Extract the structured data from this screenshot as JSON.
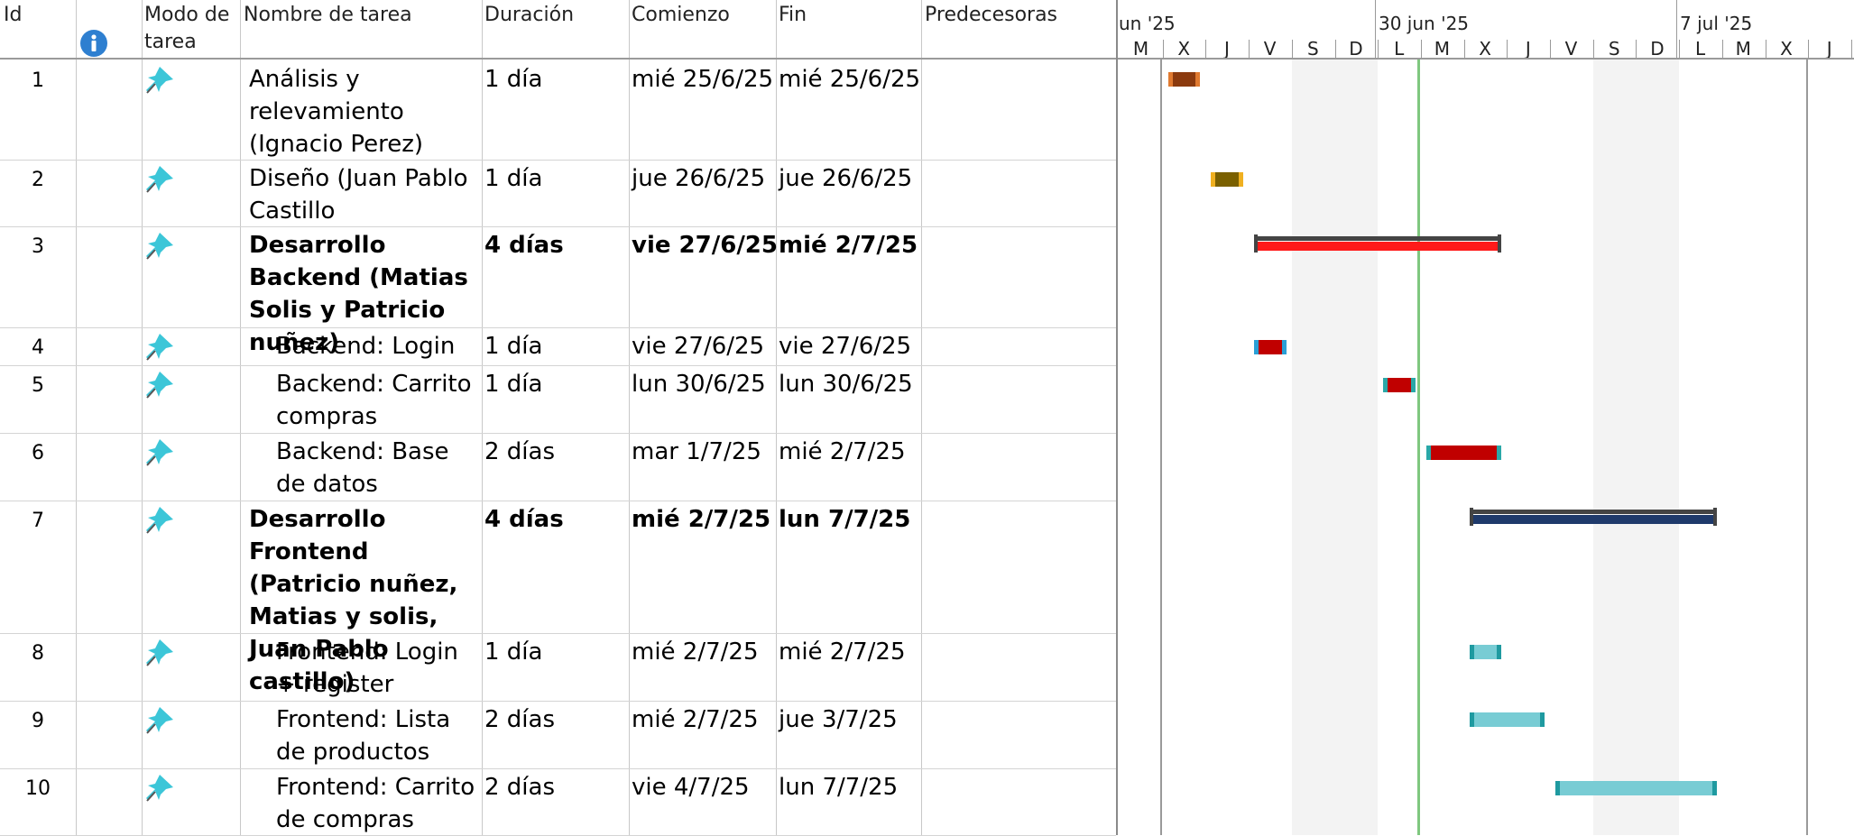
{
  "columns": {
    "id": "Id",
    "info_icon": "info-icon",
    "mode": "Modo de tarea",
    "name": "Nombre de tarea",
    "duration": "Duración",
    "start": "Comienzo",
    "finish": "Fin",
    "predecessors": "Predecesoras"
  },
  "tasks": [
    {
      "id": "1",
      "name": "Análisis y relevamiento (Ignacio Perez)",
      "duration": "1 día",
      "start": "mié 25/6/25",
      "finish": "mié 25/6/25",
      "predecessors": "",
      "summary": false,
      "indent": false,
      "bar_color": "#8b3a0e",
      "end_color": "#e07a30"
    },
    {
      "id": "2",
      "name": "Diseño (Juan Pablo Castillo",
      "duration": "1 día",
      "start": "jue 26/6/25",
      "finish": "jue 26/6/25",
      "predecessors": "",
      "summary": false,
      "indent": false,
      "bar_color": "#7a6000",
      "end_color": "#f0b020"
    },
    {
      "id": "3",
      "name": "Desarrollo Backend (Matias Solis y Patricio nuñez)",
      "duration": "4 días",
      "start": "vie 27/6/25",
      "finish": "mié 2/7/25",
      "predecessors": "",
      "summary": true,
      "indent": false,
      "bar_color": "#ff1a1a",
      "end_color": "#444444"
    },
    {
      "id": "4",
      "name": "Backend: Login",
      "duration": "1 día",
      "start": "vie 27/6/25",
      "finish": "vie 27/6/25",
      "predecessors": "",
      "summary": false,
      "indent": true,
      "bar_color": "#c00000",
      "end_color": "#2a9fd6"
    },
    {
      "id": "5",
      "name": "Backend: Carrito compras",
      "duration": "1 día",
      "start": "lun 30/6/25",
      "finish": "lun 30/6/25",
      "predecessors": "",
      "summary": false,
      "indent": true,
      "bar_color": "#c00000",
      "end_color": "#2aa8a8"
    },
    {
      "id": "6",
      "name": "Backend: Base de datos",
      "duration": "2 días",
      "start": "mar 1/7/25",
      "finish": "mié 2/7/25",
      "predecessors": "",
      "summary": false,
      "indent": true,
      "bar_color": "#c00000",
      "end_color": "#2aa8a8"
    },
    {
      "id": "7",
      "name": "Desarrollo Frontend (Patricio nuñez, Matias y solis, Juan Pablo castillo)",
      "duration": "4 días",
      "start": "mié 2/7/25",
      "finish": "lun 7/7/25",
      "predecessors": "",
      "summary": true,
      "indent": false,
      "bar_color": "#1f3a6b",
      "end_color": "#444444"
    },
    {
      "id": "8",
      "name": "Frontend: Login + register",
      "duration": "1 día",
      "start": "mié 2/7/25",
      "finish": "mié 2/7/25",
      "predecessors": "",
      "summary": false,
      "indent": true,
      "bar_color": "#78ccd4",
      "end_color": "#1f9aa0"
    },
    {
      "id": "9",
      "name": "Frontend: Lista de productos",
      "duration": "2 días",
      "start": "mié 2/7/25",
      "finish": "jue 3/7/25",
      "predecessors": "",
      "summary": false,
      "indent": true,
      "bar_color": "#78ccd4",
      "end_color": "#1f9aa0"
    },
    {
      "id": "10",
      "name": "Frontend: Carrito de compras",
      "duration": "2 días",
      "start": "vie 4/7/25",
      "finish": "lun 7/7/25",
      "predecessors": "",
      "summary": false,
      "indent": true,
      "bar_color": "#78ccd4",
      "end_color": "#1f9aa0"
    }
  ],
  "timescale": {
    "major": [
      "un '25",
      "30 jun '25",
      "7 jul '25"
    ],
    "minor": [
      "M",
      "X",
      "J",
      "V",
      "S",
      "D",
      "L",
      "M",
      "X",
      "J",
      "V",
      "S",
      "D",
      "L",
      "M",
      "X",
      "J"
    ]
  },
  "colors": {
    "today_line": "#7fc77f",
    "grid": "#c8c8c8",
    "pin_icon": "#3cc6d8"
  }
}
